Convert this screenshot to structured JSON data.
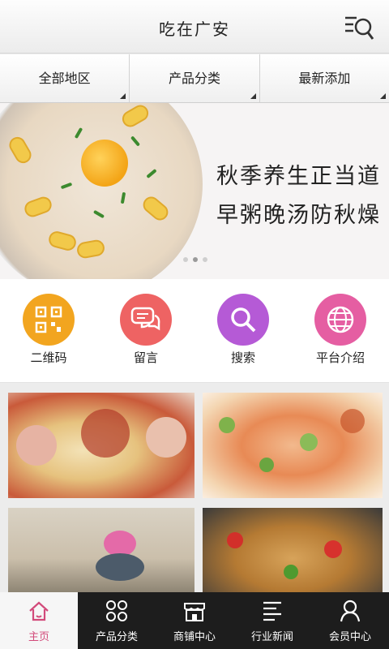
{
  "header": {
    "title": "吃在广安",
    "menu_icon": "search-menu-icon"
  },
  "filters": [
    {
      "label": "全部地区"
    },
    {
      "label": "产品分类"
    },
    {
      "label": "最新添加"
    }
  ],
  "banner": {
    "line1": "秋季养生正当道",
    "line2": "早粥晚汤防秋燥",
    "slide_count": 3,
    "active_slide": 1
  },
  "quick": [
    {
      "label": "二维码",
      "icon": "qr-code-icon",
      "color": "#f2a51f"
    },
    {
      "label": "留言",
      "icon": "message-icon",
      "color": "#ee6363"
    },
    {
      "label": "搜索",
      "icon": "search-icon",
      "color": "#b55ad6"
    },
    {
      "label": "平台介绍",
      "icon": "globe-icon",
      "color": "#e55ea2"
    }
  ],
  "tabs": [
    {
      "label": "主页",
      "icon": "home-icon",
      "active": true
    },
    {
      "label": "产品分类",
      "icon": "grid-icon"
    },
    {
      "label": "商铺中心",
      "icon": "store-icon"
    },
    {
      "label": "行业新闻",
      "icon": "news-icon"
    },
    {
      "label": "会员中心",
      "icon": "user-icon"
    }
  ],
  "colors": {
    "accent": "#d24a7a",
    "tabbar_bg": "#1d1d1d"
  }
}
